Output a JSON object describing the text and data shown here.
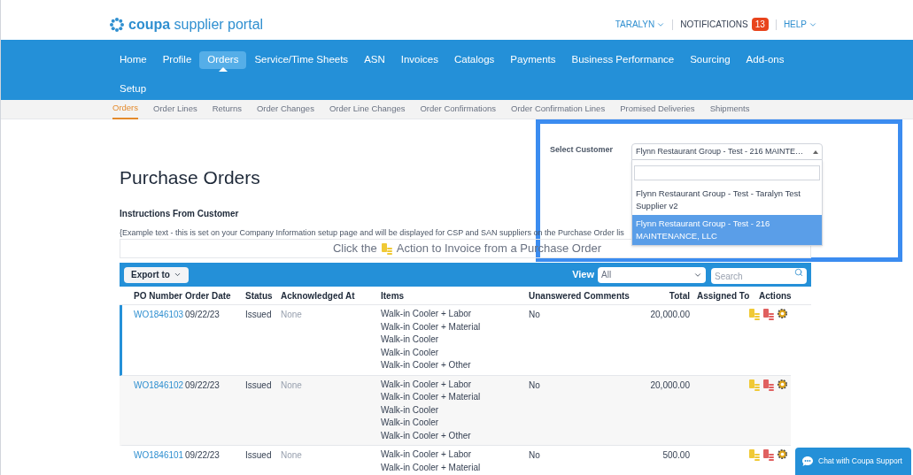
{
  "header": {
    "logo_bold": "coupa",
    "logo_text": "supplier portal",
    "user": "TARALYN",
    "notifications": "NOTIFICATIONS",
    "notification_count": "13",
    "help": "HELP"
  },
  "nav": [
    {
      "label": "Home",
      "selected": false
    },
    {
      "label": "Profile",
      "selected": false
    },
    {
      "label": "Orders",
      "selected": true
    },
    {
      "label": "Service/Time Sheets",
      "selected": false
    },
    {
      "label": "ASN",
      "selected": false
    },
    {
      "label": "Invoices",
      "selected": false
    },
    {
      "label": "Catalogs",
      "selected": false
    },
    {
      "label": "Payments",
      "selected": false
    },
    {
      "label": "Business Performance",
      "selected": false
    },
    {
      "label": "Sourcing",
      "selected": false
    },
    {
      "label": "Add-ons",
      "selected": false
    },
    {
      "label": "Setup",
      "selected": false
    }
  ],
  "subnav": [
    {
      "label": "Orders",
      "selected": true
    },
    {
      "label": "Order Lines",
      "selected": false
    },
    {
      "label": "Returns",
      "selected": false
    },
    {
      "label": "Order Changes",
      "selected": false
    },
    {
      "label": "Order Line Changes",
      "selected": false
    },
    {
      "label": "Order Confirmations",
      "selected": false
    },
    {
      "label": "Order Confirmation Lines",
      "selected": false
    },
    {
      "label": "Promised Deliveries",
      "selected": false
    },
    {
      "label": "Shipments",
      "selected": false
    }
  ],
  "title": "Purchase Orders",
  "instructions_heading": "Instructions From Customer",
  "instructions_text": "{Example text - this is set on your Company Information setup page and will be displayed for CSP and SAN suppliers on the Purchase Order lis",
  "invoice_hint": {
    "before": "Click the",
    "after": "Action to Invoice from a Purchase Order"
  },
  "customer_select": {
    "label": "Select Customer",
    "value": "Flynn Restaurant Group - Test - 216 MAINTE…",
    "expanded": true,
    "options": [
      {
        "label": "Flynn Restaurant Group - Test - Taralyn Test Supplier v2",
        "selected": false
      },
      {
        "label": "Flynn Restaurant Group - Test - 216 MAINTENANCE, LLC",
        "selected": true
      }
    ]
  },
  "toolbar": {
    "export": "Export to",
    "view_label": "View",
    "view_value": "All",
    "search_placeholder": "Search"
  },
  "table": {
    "columns": [
      "PO Number",
      "Order Date",
      "Status",
      "Acknowledged At",
      "Items",
      "Unanswered Comments",
      "Total",
      "Assigned To",
      "Actions"
    ],
    "rows": [
      {
        "po": "WO1846103",
        "date": "09/22/23",
        "status": "Issued",
        "acknowledged": "None",
        "items": [
          "Walk-in Cooler + Labor",
          "Walk-in Cooler + Material",
          "Walk-in Cooler",
          "Walk-in Cooler",
          "Walk-in Cooler + Other"
        ],
        "comments": "No",
        "total": "20,000.00",
        "selected": true
      },
      {
        "po": "WO1846102",
        "date": "09/22/23",
        "status": "Issued",
        "acknowledged": "None",
        "items": [
          "Walk-in Cooler + Labor",
          "Walk-in Cooler + Material",
          "Walk-in Cooler",
          "Walk-in Cooler",
          "Walk-in Cooler + Other"
        ],
        "comments": "No",
        "total": "20,000.00",
        "selected": false
      },
      {
        "po": "WO1846101",
        "date": "09/22/23",
        "status": "Issued",
        "acknowledged": "None",
        "items": [
          "Walk-in Cooler + Labor",
          "Walk-in Cooler + Material"
        ],
        "comments": "No",
        "total": "500.00",
        "selected": false
      }
    ]
  },
  "chat": "Chat with Coupa Support"
}
